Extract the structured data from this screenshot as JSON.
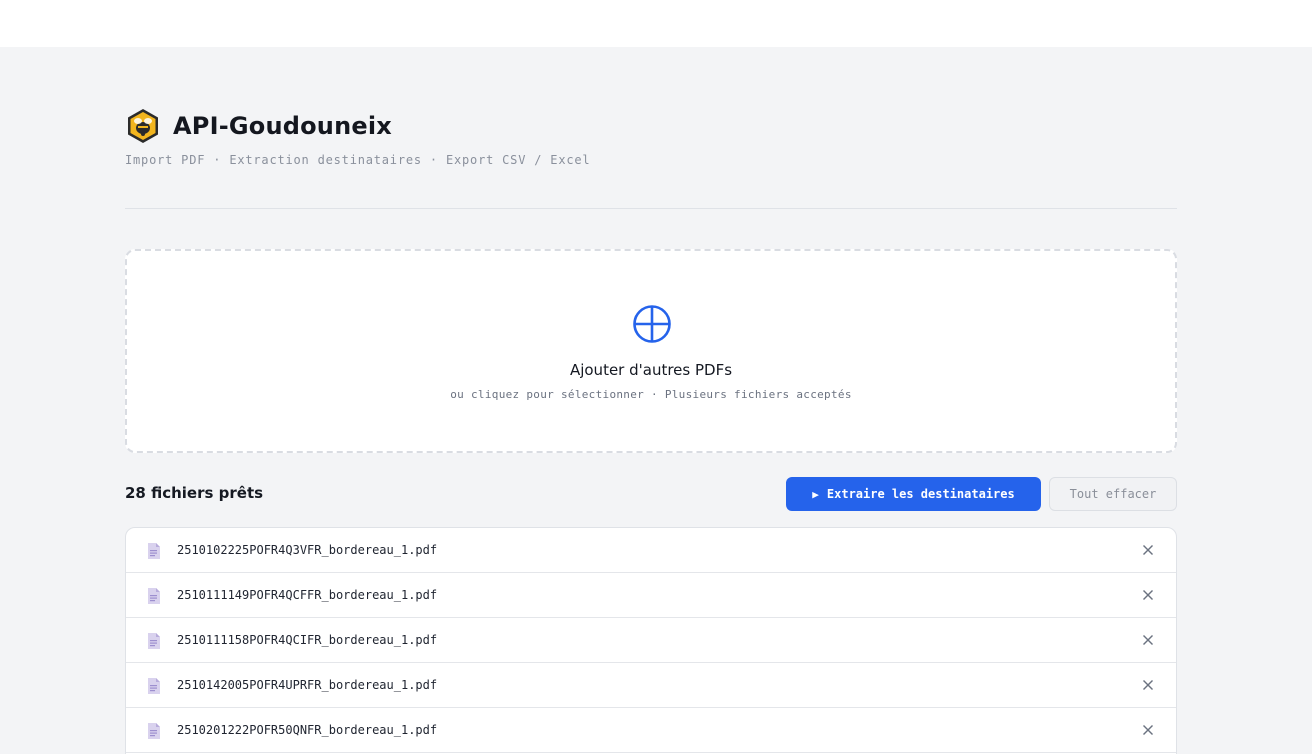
{
  "header": {
    "app_title": "API-Goudouneix",
    "subtitle": "Import PDF · Extraction destinataires · Export CSV / Excel",
    "logo_icon": "bee-hexagon-logo"
  },
  "dropzone": {
    "icon": "plus-circle-icon",
    "title": "Ajouter d'autres PDFs",
    "subtitle": "ou cliquez pour sélectionner · Plusieurs fichiers acceptés"
  },
  "files": {
    "count_label": "28 fichiers prêts",
    "extract_button": "Extraire les destinataires",
    "clear_button": "Tout effacer",
    "items": [
      {
        "name": "2510102225POFR4Q3VFR_bordereau_1.pdf"
      },
      {
        "name": "2510111149POFR4QCFFR_bordereau_1.pdf"
      },
      {
        "name": "2510111158POFR4QCIFR_bordereau_1.pdf"
      },
      {
        "name": "2510142005POFR4UPRFR_bordereau_1.pdf"
      },
      {
        "name": "2510201222POFR50QNFR_bordereau_1.pdf"
      }
    ]
  },
  "colors": {
    "accent": "#2563eb",
    "background": "#f3f4f6",
    "file_icon": "#c9bfe6",
    "logo_fill": "#f2b51e"
  }
}
